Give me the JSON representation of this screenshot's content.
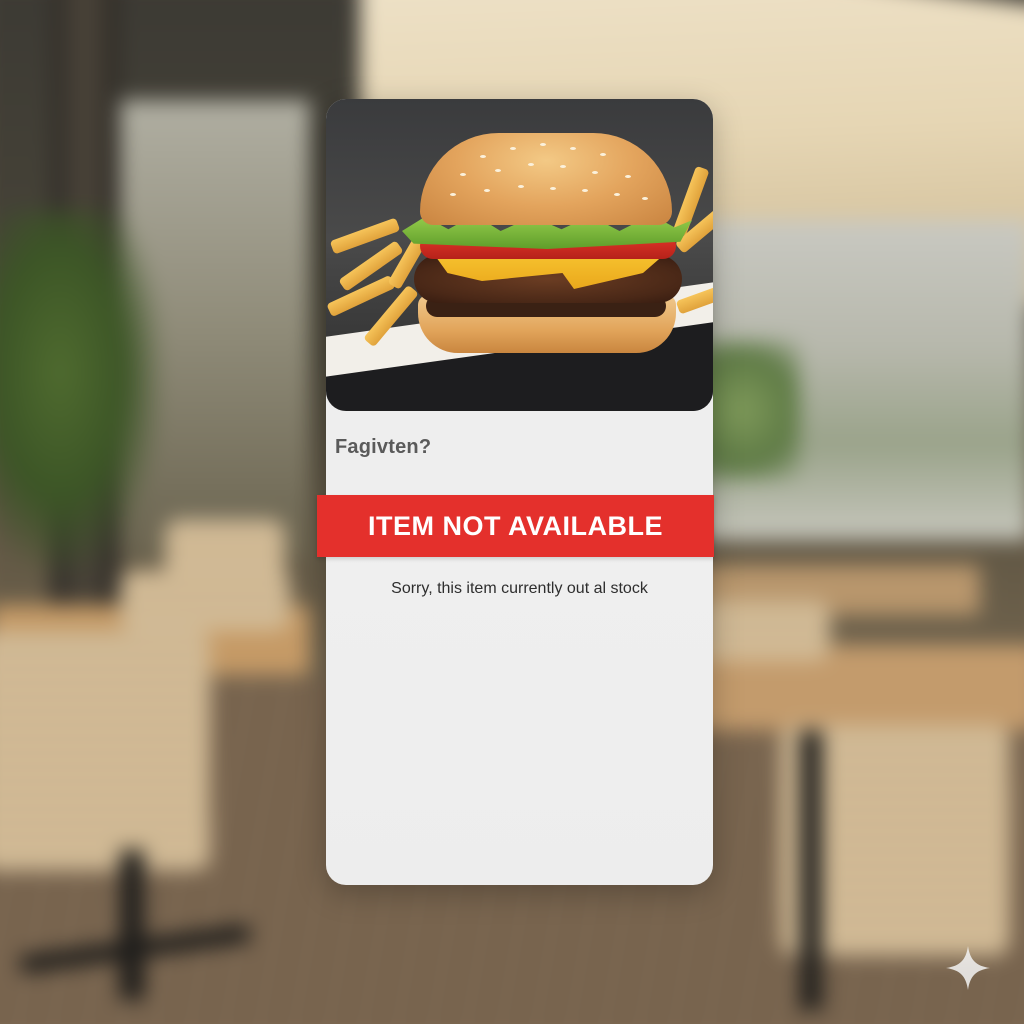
{
  "item_card": {
    "title": "Fagivten?",
    "status_banner": "ITEM NOT AVAILABLE",
    "status_message": "Sorry, this item currently out al stock",
    "image": "burger-with-fries"
  },
  "colors": {
    "banner": "#e4302c",
    "card_background": "#ececec",
    "title_text": "#5a5a5a"
  },
  "icons": {
    "watermark": "sparkle-icon"
  }
}
